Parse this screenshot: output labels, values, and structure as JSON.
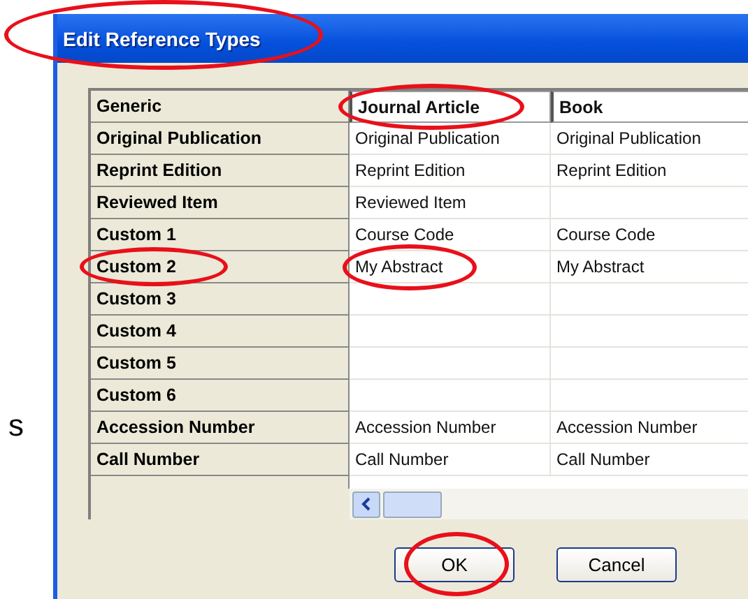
{
  "side_text": "s",
  "window": {
    "title": "Edit Reference Types",
    "title_circled": true
  },
  "columns": [
    {
      "label": "Generic",
      "circled": false
    },
    {
      "label": "Journal Article",
      "circled": true
    },
    {
      "label": "Book",
      "circled": false
    }
  ],
  "rows": [
    {
      "label": "Original Publication",
      "circled": false,
      "cells": [
        {
          "text": "Original Publication",
          "circled": false
        },
        {
          "text": "Original Publication",
          "circled": false
        }
      ]
    },
    {
      "label": "Reprint Edition",
      "circled": false,
      "cells": [
        {
          "text": "Reprint Edition",
          "circled": false
        },
        {
          "text": "Reprint Edition",
          "circled": false
        }
      ]
    },
    {
      "label": "Reviewed Item",
      "circled": false,
      "cells": [
        {
          "text": "Reviewed Item",
          "circled": false
        },
        {
          "circled": false
        }
      ]
    },
    {
      "label": "Custom 1",
      "circled": false,
      "cells": [
        {
          "text": "Course Code",
          "circled": false
        },
        {
          "text": "Course Code",
          "circled": false
        }
      ]
    },
    {
      "label": "Custom 2",
      "circled": true,
      "cells": [
        {
          "text": "My Abstract",
          "circled": true
        },
        {
          "text": "My Abstract",
          "circled": false
        }
      ]
    },
    {
      "label": "Custom 3",
      "circled": false,
      "cells": [
        {
          "circled": false
        },
        {
          "circled": false
        }
      ]
    },
    {
      "label": "Custom 4",
      "circled": false,
      "cells": [
        {
          "circled": false
        },
        {
          "circled": false
        }
      ]
    },
    {
      "label": "Custom 5",
      "circled": false,
      "cells": [
        {
          "circled": false
        },
        {
          "circled": false
        }
      ]
    },
    {
      "label": "Custom 6",
      "circled": false,
      "cells": [
        {
          "circled": false
        },
        {
          "circled": false
        }
      ]
    },
    {
      "label": "Accession Number",
      "circled": false,
      "cells": [
        {
          "text": "Accession Number",
          "circled": false
        },
        {
          "text": "Accession Number",
          "circled": false
        }
      ]
    },
    {
      "label": "Call Number",
      "circled": false,
      "cells": [
        {
          "text": "Call Number",
          "circled": false
        },
        {
          "text": "Call Number",
          "circled": false
        }
      ]
    }
  ],
  "buttons": [
    {
      "label": "OK",
      "circled": true
    },
    {
      "label": "Cancel",
      "circled": false
    }
  ]
}
